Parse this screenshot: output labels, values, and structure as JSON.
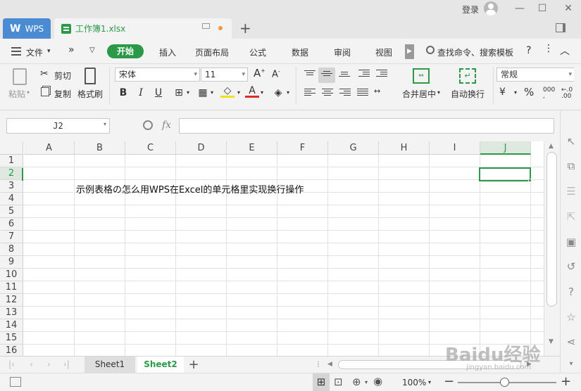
{
  "title_bar": {
    "login_label": "登录",
    "tabs": [
      {
        "label": "WPS"
      },
      {
        "label": "工作簿1.xlsx"
      }
    ]
  },
  "menu": {
    "file_label": "文件",
    "items": [
      "开始",
      "插入",
      "页面布局",
      "公式",
      "数据",
      "审阅",
      "视图"
    ],
    "search_label": "查找命令、搜索模板",
    "help_label": "?"
  },
  "ribbon": {
    "paste_label": "粘贴",
    "cut_label": "剪切",
    "copy_label": "复制",
    "format_painter_label": "格式刷",
    "font_name": "宋体",
    "font_size": "11",
    "merge_label": "合并居中",
    "wrap_label": "自动换行",
    "number_format": "常规"
  },
  "formula_bar": {
    "name_box": "J2",
    "fx_label": "fx",
    "formula": ""
  },
  "grid": {
    "columns": [
      "A",
      "B",
      "C",
      "D",
      "E",
      "F",
      "G",
      "H",
      "I",
      "J"
    ],
    "rows": [
      "1",
      "2",
      "3",
      "4",
      "5",
      "6",
      "7",
      "8",
      "9",
      "10",
      "11",
      "12",
      "13",
      "14",
      "15",
      "16"
    ],
    "cells": {
      "B3": "示例表格の怎么用WPS在Excel的单元格里实现换行操作"
    },
    "active_cell": "J2"
  },
  "sheets": [
    {
      "label": "Sheet1",
      "active": false
    },
    {
      "label": "Sheet2",
      "active": true
    }
  ],
  "status": {
    "zoom": "100%"
  },
  "watermark": {
    "brand": "Baidu经验",
    "url": "jingyan.baidu.com"
  },
  "colors": {
    "accent": "#2a9a48",
    "wps_tab": "#4a8bd4"
  }
}
